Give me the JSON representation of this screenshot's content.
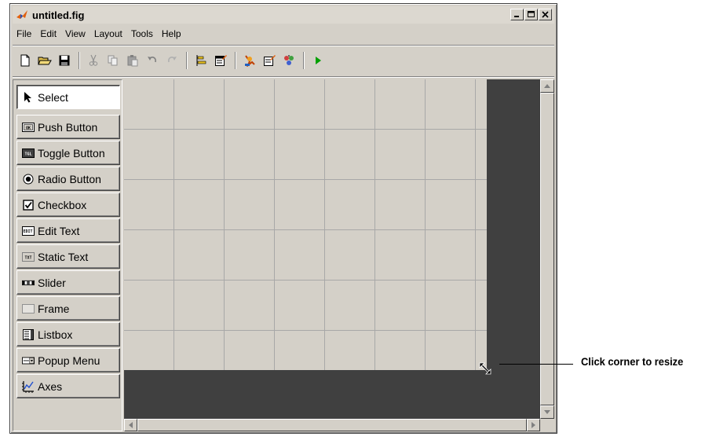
{
  "window": {
    "title": "untitled.fig",
    "controls": {
      "minimize": "_",
      "maximize": "□",
      "close": "×"
    }
  },
  "menu": [
    "File",
    "Edit",
    "View",
    "Layout",
    "Tools",
    "Help"
  ],
  "toolbar": [
    "new-icon",
    "open-icon",
    "save-icon",
    "|",
    "cut-icon",
    "copy-icon",
    "paste-icon",
    "undo-icon",
    "redo-icon",
    "|",
    "align-icon",
    "menu-editor-icon",
    "|",
    "property-inspector-icon",
    "object-browser-icon",
    "tab-order-icon",
    "|",
    "run-icon"
  ],
  "palette": {
    "items": [
      {
        "label": "Select",
        "icon": "arrow-icon",
        "selected": true
      },
      {
        "label": "Push Button",
        "icon": "push-button-icon"
      },
      {
        "label": "Toggle Button",
        "icon": "toggle-button-icon"
      },
      {
        "label": "Radio Button",
        "icon": "radio-button-icon"
      },
      {
        "label": "Checkbox",
        "icon": "checkbox-icon"
      },
      {
        "label": "Edit Text",
        "icon": "edit-text-icon"
      },
      {
        "label": "Static Text",
        "icon": "static-text-icon"
      },
      {
        "label": "Slider",
        "icon": "slider-icon"
      },
      {
        "label": "Frame",
        "icon": "frame-icon"
      },
      {
        "label": "Listbox",
        "icon": "listbox-icon"
      },
      {
        "label": "Popup Menu",
        "icon": "popup-menu-icon"
      },
      {
        "label": "Axes",
        "icon": "axes-icon"
      }
    ]
  },
  "icon_text": {
    "ok": "OK",
    "tgl": "TGL",
    "edt": "EDIT",
    "txt": "TXT"
  },
  "callout": {
    "text": "Click corner to resize"
  },
  "colors": {
    "canvas_bg": "#404040",
    "grid_bg": "#d4d0c8",
    "face": "#d4d0c8",
    "run_green": "#00a000"
  }
}
